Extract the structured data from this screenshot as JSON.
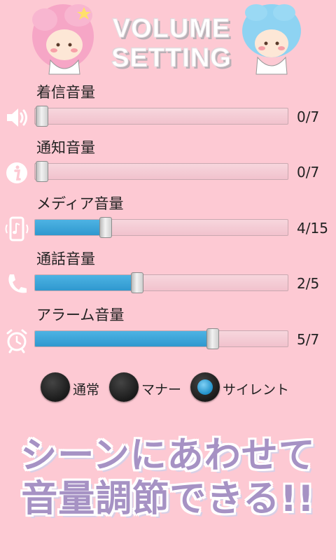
{
  "header": {
    "title_line1": "VOLUME",
    "title_line2": "SETTING"
  },
  "sliders": [
    {
      "label": "着信音量",
      "value_text": "0/7",
      "fraction": 0.0,
      "icon": "speaker-icon"
    },
    {
      "label": "通知音量",
      "value_text": "0/7",
      "fraction": 0.0,
      "icon": "info-icon"
    },
    {
      "label": "メディア音量",
      "value_text": "4/15",
      "fraction": 0.2667,
      "icon": "phone-music-icon"
    },
    {
      "label": "通話音量",
      "value_text": "2/5",
      "fraction": 0.4,
      "icon": "phone-handset-icon"
    },
    {
      "label": "アラーム音量",
      "value_text": "5/7",
      "fraction": 0.7143,
      "icon": "alarm-clock-icon"
    }
  ],
  "modes": [
    {
      "label": "通常",
      "selected": false
    },
    {
      "label": "マナー",
      "selected": false
    },
    {
      "label": "サイレント",
      "selected": true
    }
  ],
  "promo": {
    "line1": "シーンにあわせて",
    "line2": "音量調節できる!!"
  },
  "colors": {
    "background": "#fdc9d3",
    "fill": "#2f98cf",
    "promo": "#a692c4"
  }
}
